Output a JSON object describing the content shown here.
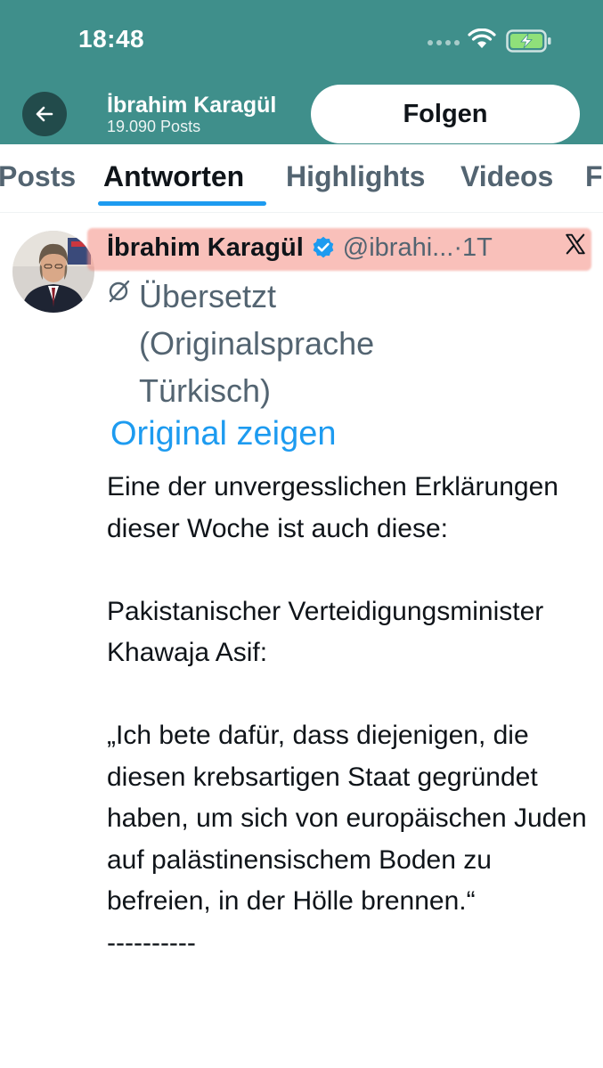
{
  "status_bar": {
    "time": "18:48"
  },
  "header": {
    "name": "İbrahim Karagül",
    "posts_count": "19.090 Posts",
    "follow_label": "Folgen"
  },
  "tabs": [
    "Posts",
    "Antworten",
    "Highlights",
    "Videos",
    "F"
  ],
  "active_tab": "Antworten",
  "tweet": {
    "author_name": "İbrahim Karagül",
    "handle": "@ibrahi...",
    "time": "·1T",
    "translation_note": "Übersetzt (Originalsprache Türkisch)",
    "show_original": "Original zeigen",
    "paragraphs": [
      "Eine der unvergesslichen Erklärungen dieser Woche ist auch diese:",
      "Pakistanischer Verteidigungsminister Khawaja Asif:",
      "„Ich bete dafür, dass diejenigen, die diesen krebsartigen Staat gegründet haben, um sich von europäischen Juden auf palästinensischem Boden zu befreien, in der Hölle brennen.“\n----------"
    ]
  },
  "colors": {
    "header_bg": "#3f8f8b",
    "accent": "#1d9bf0",
    "highlight": "#f48c82",
    "text_secondary": "#536471"
  }
}
